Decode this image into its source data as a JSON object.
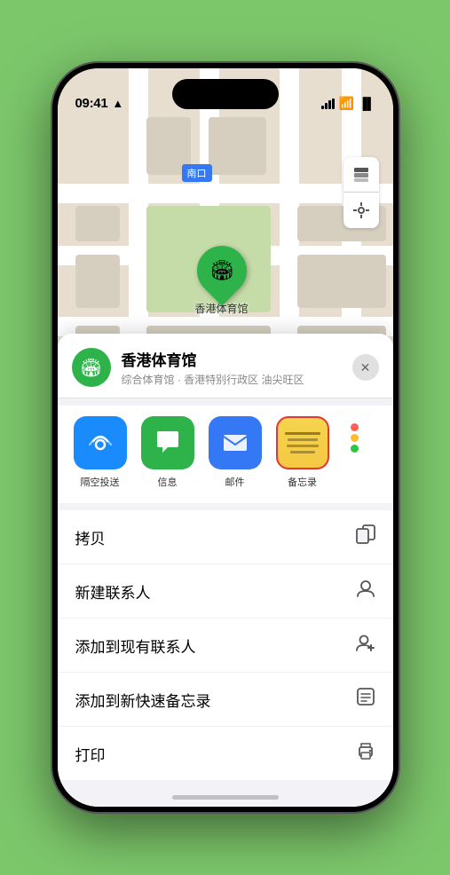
{
  "status_bar": {
    "time": "09:41",
    "location_arrow": "▶"
  },
  "map": {
    "location_label": "南口",
    "venue_name_on_map": "香港体育馆",
    "map_btn_layers": "⊞",
    "map_btn_location": "⌖"
  },
  "bottom_sheet": {
    "venue_icon": "🏟",
    "venue_name": "香港体育馆",
    "venue_desc": "综合体育馆 · 香港特别行政区 油尖旺区",
    "close_label": "✕"
  },
  "share_items": [
    {
      "id": "airdrop",
      "label": "隔空投送",
      "type": "airdrop"
    },
    {
      "id": "messages",
      "label": "信息",
      "type": "messages"
    },
    {
      "id": "mail",
      "label": "邮件",
      "type": "mail"
    },
    {
      "id": "notes",
      "label": "备忘录",
      "type": "notes"
    }
  ],
  "more_dots": [
    "#ff5f57",
    "#febc2e",
    "#28c840"
  ],
  "action_items": [
    {
      "id": "copy",
      "label": "拷贝",
      "icon": "⎘"
    },
    {
      "id": "new-contact",
      "label": "新建联系人",
      "icon": "👤"
    },
    {
      "id": "add-existing",
      "label": "添加到现有联系人",
      "icon": "👤"
    },
    {
      "id": "add-note",
      "label": "添加到新快速备忘录",
      "icon": "⊞"
    },
    {
      "id": "print",
      "label": "打印",
      "icon": "🖨"
    }
  ]
}
